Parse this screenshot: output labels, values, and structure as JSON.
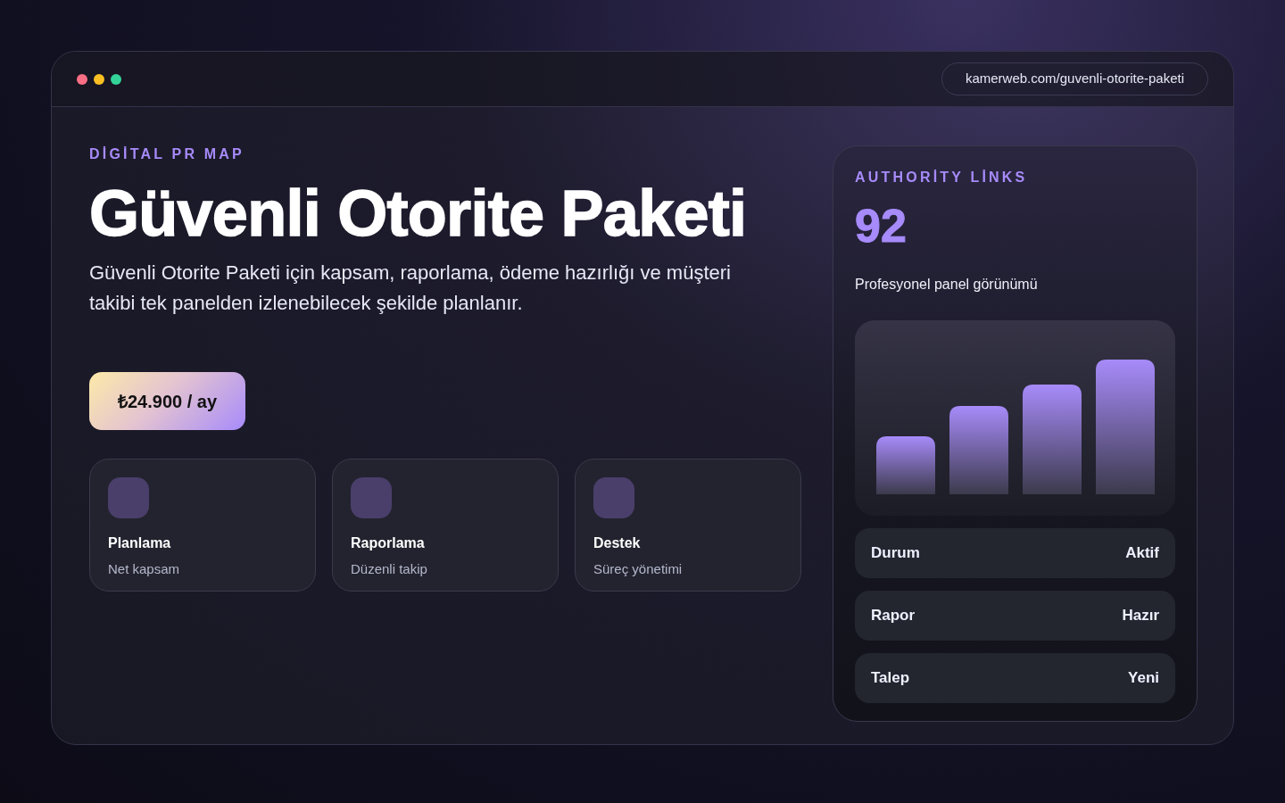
{
  "window": {
    "url": "kamerweb.com/guvenli-otorite-paketi"
  },
  "hero": {
    "eyebrow": "DİGİTAL PR MAP",
    "title": "Güvenli Otorite Paketi",
    "description": "Güvenli Otorite Paketi için kapsam, raporlama, ödeme hazırlığı ve müşteri takibi tek panelden izlenebilecek şekilde planlanır.",
    "price": "₺24.900 / ay"
  },
  "features": [
    {
      "title": "Planlama",
      "subtitle": "Net kapsam"
    },
    {
      "title": "Raporlama",
      "subtitle": "Düzenli takip"
    },
    {
      "title": "Destek",
      "subtitle": "Süreç yönetimi"
    }
  ],
  "panel": {
    "eyebrow": "AUTHORİTY LİNKS",
    "score": "92",
    "caption": "Profesyonel panel görünümü",
    "status_rows": [
      {
        "label": "Durum",
        "value": "Aktif"
      },
      {
        "label": "Rapor",
        "value": "Hazır"
      },
      {
        "label": "Talep",
        "value": "Yeni"
      }
    ]
  }
}
